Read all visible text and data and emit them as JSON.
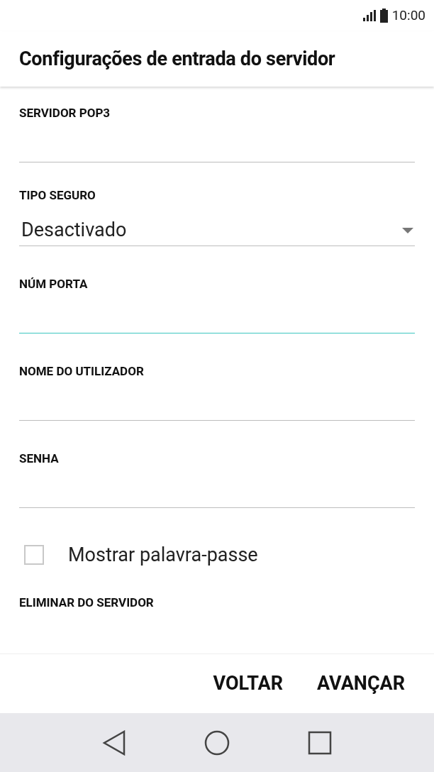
{
  "status_bar": {
    "time": "10:00"
  },
  "title": "Configurações de entrada do servidor",
  "fields": [
    {
      "kind": "text",
      "label": "SERVIDOR POP3",
      "focused": false
    },
    {
      "kind": "dropdown",
      "label": "TIPO SEGURO",
      "value": "Desactivado",
      "focused": false
    },
    {
      "kind": "text",
      "label": "NÚM PORTA",
      "focused": true
    },
    {
      "kind": "text",
      "label": "NOME DO UTILIZADOR",
      "focused": false
    },
    {
      "kind": "text",
      "label": "SENHA",
      "focused": false
    }
  ],
  "checkbox": {
    "label": "Mostrar palavra-passe",
    "checked": false
  },
  "next_section": "ELIMINAR DO SERVIDOR",
  "buttons": [
    "VOLTAR",
    "AVANÇAR"
  ]
}
